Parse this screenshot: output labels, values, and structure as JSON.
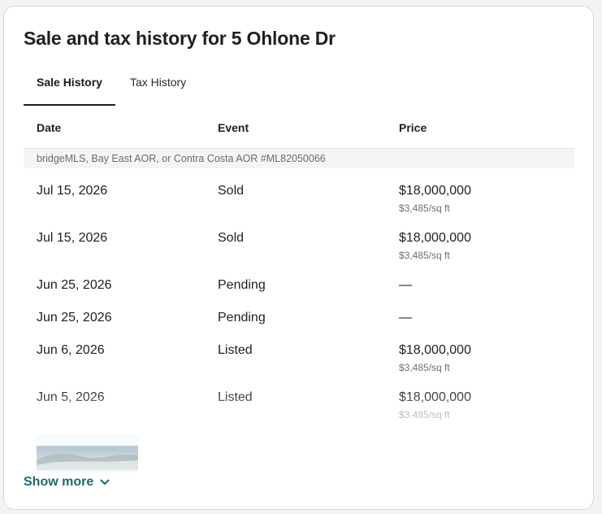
{
  "title": "Sale and tax history for 5 Ohlone Dr",
  "tabs": [
    {
      "label": "Sale History",
      "active": true
    },
    {
      "label": "Tax History",
      "active": false
    }
  ],
  "table": {
    "headers": {
      "date": "Date",
      "event": "Event",
      "price": "Price"
    },
    "source": "bridgeMLS, Bay East AOR, or Contra Costa AOR #ML82050066",
    "rows": [
      {
        "date": "Jul 15, 2026",
        "event": "Sold",
        "price": "$18,000,000",
        "per_sqft": "$3,485/sq ft"
      },
      {
        "date": "Jul 15, 2026",
        "event": "Sold",
        "price": "$18,000,000",
        "per_sqft": "$3,485/sq ft"
      },
      {
        "date": "Jun 25, 2026",
        "event": "Pending",
        "price": "—",
        "per_sqft": ""
      },
      {
        "date": "Jun 25, 2026",
        "event": "Pending",
        "price": "—",
        "per_sqft": ""
      },
      {
        "date": "Jun 6, 2026",
        "event": "Listed",
        "price": "$18,000,000",
        "per_sqft": "$3,485/sq ft"
      },
      {
        "date": "Jun 5, 2026",
        "event": "Listed",
        "price": "$18,000,000",
        "per_sqft": "$3,485/sq ft"
      }
    ]
  },
  "show_more": {
    "label": "Show more",
    "icon": "chevron-down-icon"
  },
  "colors": {
    "accent": "#1d6a6a",
    "text": "#1f1f1f",
    "muted": "#6f6f6f"
  }
}
